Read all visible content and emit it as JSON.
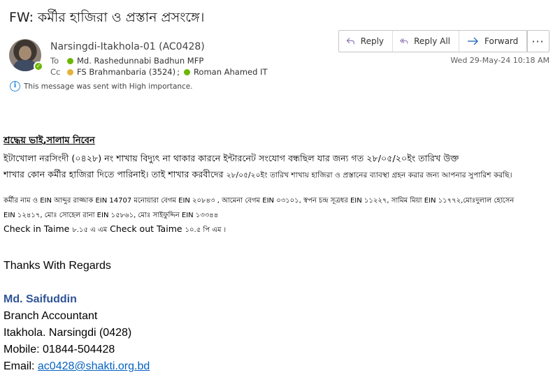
{
  "message": {
    "subject": "FW: কর্মীর হাজিরা ও প্রস্তান প্রসংঙ্গে।",
    "sender": "Narsingdi-Itakhola-01 (AC0428)",
    "to_label": "To",
    "cc_label": "Cc",
    "to": [
      {
        "name": "Md. Rashedunnabi Badhun MFP",
        "status_color": "#6bb700"
      }
    ],
    "cc": [
      {
        "name": "FS Brahmanbaria (3524)",
        "status_color": "#e3b43b"
      },
      {
        "name": "Roman Ahamed IT",
        "status_color": "#6bb700"
      }
    ],
    "importance_note": "This message was sent with High importance.",
    "timestamp": "Wed 29-May-24 10:18 AM"
  },
  "actions": {
    "reply": "Reply",
    "reply_all": "Reply All",
    "forward": "Forward",
    "more": "···"
  },
  "body": {
    "greeting": "শ্রদ্ধেয় ভাই,সালাম নিবেন",
    "para1_line1": "ইটাখোলা নরসিংদী (০৪২৮) নং শাখায় বিদ্যুৎ না থাকার কারনে ইন্টারনেট সংযোগ বন্ধছিল যার জন্য গত ২৮/০৫/২০ইং তারিখ উক্ত",
    "para1_line2a": "শাখার কোন কর্মীর হাজিরা দিতে পারিনাই। তাই শাখার করবীদের",
    "para1_line2b": "২৮/০৫/২০ইং তারিখ শাখায় হাজিরা ও প্রস্তানের ব্যাবস্থা গ্রহন করার জন্য আপনার সুপারিশ করছি।",
    "para2_line1": "কর্মীর নাম ও EIN  আব্দুর রাজ্জাক  EIN 14707 মনোয়ারা বেগম EIN ২০৮৪৩ , আমেনা বেগম EIN  ০৩১০১, স্বপন চন্দ্র সূত্রধর EIN ১১২২৭,  সামিম মিয়া EIN ১১৭৭২,মোঃদুলাল হোসেন",
    "para2_line2": "EIN ১২৪১৭, মোঃ সোহেল রানা EIN  ১৫৮৬১, মোঃ সাইফুদ্দিন EIN ১৩৩৪৪",
    "checkin_a": "Check in Taime",
    "checkin_b": "৮.১৫ এ এম",
    "checkin_c": "Check out  Taime",
    "checkin_d": "১০.৫ পি এম ।"
  },
  "signature": {
    "thanks": "Thanks With Regards",
    "name": "Md. Saifuddin",
    "title": "Branch Accountant",
    "location": "Itakhola. Narsingdi (0428)",
    "mobile": "Mobile: 01844-504428",
    "email_label": "Email: ",
    "email": "ac0428@shakti.org.bd"
  }
}
